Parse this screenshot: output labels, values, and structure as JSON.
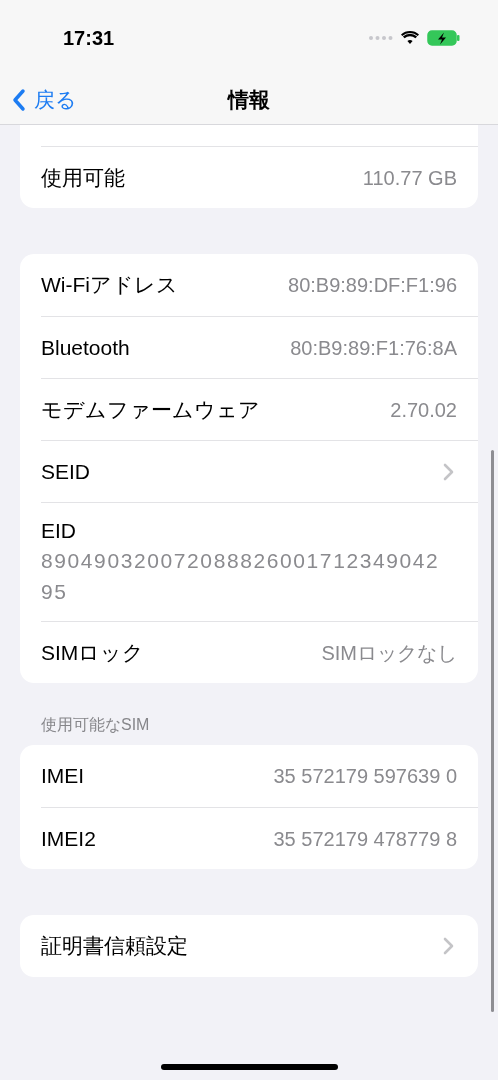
{
  "status_bar": {
    "time": "17:31"
  },
  "nav": {
    "back": "戻る",
    "title": "情報"
  },
  "groups": [
    {
      "cut_top": true,
      "rows": [
        {
          "kind": "value",
          "label": "使用可能",
          "value": "110.77 GB"
        }
      ]
    },
    {
      "rows": [
        {
          "kind": "value",
          "label": "Wi-Fiアドレス",
          "value": "80:B9:89:DF:F1:96"
        },
        {
          "kind": "value",
          "label": "Bluetooth",
          "value": "80:B9:89:F1:76:8A"
        },
        {
          "kind": "value",
          "label": "モデムファームウェア",
          "value": "2.70.02"
        },
        {
          "kind": "chevron",
          "label": "SEID"
        },
        {
          "kind": "stacked",
          "label": "EID",
          "value": "89049032007208882600171234904295"
        },
        {
          "kind": "value",
          "label": "SIMロック",
          "value": "SIMロックなし"
        }
      ]
    },
    {
      "header": "使用可能なSIM",
      "rows": [
        {
          "kind": "value",
          "label": "IMEI",
          "value": "35 572179 597639 0"
        },
        {
          "kind": "value",
          "label": "IMEI2",
          "value": "35 572179 478779 8"
        }
      ]
    },
    {
      "rows": [
        {
          "kind": "chevron",
          "label": "証明書信頼設定"
        }
      ]
    }
  ]
}
